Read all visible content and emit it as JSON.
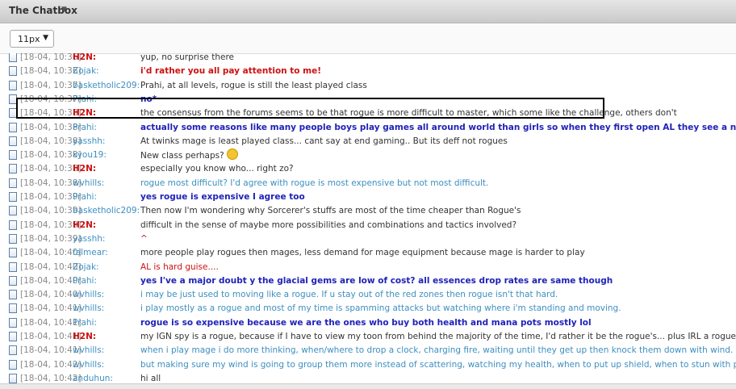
{
  "header": {
    "title": "The Chatbox"
  },
  "toolbar": {
    "font_size": "11px"
  },
  "messages": [
    {
      "time": "[18-04, 10:36]",
      "user": "H2N:",
      "user_style": "red",
      "text": "yup, no surprise there",
      "style": "normal"
    },
    {
      "time": "[18-04, 10:36]",
      "user": "Zojak:",
      "user_style": "blue",
      "text": "i'd rather you all pay attention to me!",
      "style": "redb"
    },
    {
      "time": "[18-04, 10:37]",
      "user": "basketholic209:",
      "user_style": "blue",
      "text": "Prahi, at all levels, rogue is still the least played class",
      "style": "normal"
    },
    {
      "time": "[18-04, 10:37]",
      "user": "Prahi:",
      "user_style": "blue",
      "text": "no*",
      "style": "blue"
    },
    {
      "time": "[18-04, 10:38]",
      "user": "H2N:",
      "user_style": "red",
      "text": "the consensus from the forums seems to be that rogue is more difficult to master, which some like the challenge, others don't",
      "style": "normal"
    },
    {
      "time": "[18-04, 10:38]",
      "user": "Prahi:",
      "user_style": "blue",
      "text": "actually some reasons like many people boys play games all around world than girls so when they first open AL they see a nice fat warrior and choose it",
      "style": "blue"
    },
    {
      "time": "[18-04, 10:38]",
      "user": "yasshh:",
      "user_style": "blue",
      "text": "At twinks mage is least played class... cant say at end gaming.. But its deff not rogues",
      "style": "normal"
    },
    {
      "time": "[18-04, 10:38]",
      "user": "kyou19:",
      "user_style": "blue",
      "text": "New class perhaps?",
      "style": "normal",
      "emoji": true
    },
    {
      "time": "[18-04, 10:38]",
      "user": "H2N:",
      "user_style": "red",
      "text": "especially you know who... right zo?",
      "style": "normal"
    },
    {
      "time": "[18-04, 10:38]",
      "user": "wvhills:",
      "user_style": "blue",
      "text": "rogue most difficult? I'd agree with rogue is most expensive but not most difficult.",
      "style": "lblue"
    },
    {
      "time": "[18-04, 10:39]",
      "user": "Prahi:",
      "user_style": "blue",
      "text": "yes rogue is expensive I agree too",
      "style": "blue"
    },
    {
      "time": "[18-04, 10:39]",
      "user": "basketholic209:",
      "user_style": "blue",
      "text": "Then now I'm wondering why Sorcerer's stuffs are most of the time cheaper than Rogue's",
      "style": "normal"
    },
    {
      "time": "[18-04, 10:39]",
      "user": "H2N:",
      "user_style": "red",
      "text": "difficult in the sense of maybe more possibilities and combinations and tactics involved?",
      "style": "normal"
    },
    {
      "time": "[18-04, 10:39]",
      "user": "yasshh:",
      "user_style": "blue",
      "text": "^",
      "style": "red"
    },
    {
      "time": "[18-04, 10:40]",
      "user": "falmear:",
      "user_style": "blue",
      "text": "more people play rogues then mages, less demand for mage equipment because mage is harder to play",
      "style": "normal"
    },
    {
      "time": "[18-04, 10:40]",
      "user": "Zojak:",
      "user_style": "blue",
      "text": "AL is hard guise....",
      "style": "red"
    },
    {
      "time": "[18-04, 10:40]",
      "user": "Prahi:",
      "user_style": "blue",
      "text": "yes I've a major doubt y the glacial gems are low of cost? all essences drop rates are same though",
      "style": "blue"
    },
    {
      "time": "[18-04, 10:40]",
      "user": "wvhills:",
      "user_style": "blue",
      "text": "i may be just used to moving like a rogue. If u stay out of the red zones then rogue isn't that hard.",
      "style": "lblue"
    },
    {
      "time": "[18-04, 10:41]",
      "user": "wvhills:",
      "user_style": "blue",
      "text": "i play mostly as a rogue and most of my time is spamming attacks but watching where i'm standing and moving.",
      "style": "lblue"
    },
    {
      "time": "[18-04, 10:41]",
      "user": "Prahi:",
      "user_style": "blue",
      "text": "rogue is so expensive because we are the ones who buy both health and mana pots mostly lol",
      "style": "blue"
    },
    {
      "time": "[18-04, 10:41]",
      "user": "H2N:",
      "user_style": "red",
      "text": "my IGN spy is a rogue, because if I have to view my toon from behind the majority of the time, I'd rather it be the rogue's... plus IRL a rogue makes a better spy",
      "style": "normal"
    },
    {
      "time": "[18-04, 10:41]",
      "user": "wvhills:",
      "user_style": "blue",
      "text": "when i play mage i do more thinking, when/where to drop a clock, charging fire, waiting until they get up then knock them down with wind.",
      "style": "lblue"
    },
    {
      "time": "[18-04, 10:42]",
      "user": "wvhills:",
      "user_style": "blue",
      "text": "but making sure my wind is going to group them more instead of scattering, watching my health, when to put up shield, when to stun with pet, etc.",
      "style": "lblue"
    },
    {
      "time": "[18-04, 10:42]",
      "user": "anduhun:",
      "user_style": "blue",
      "text": "hi all",
      "style": "normal"
    }
  ]
}
